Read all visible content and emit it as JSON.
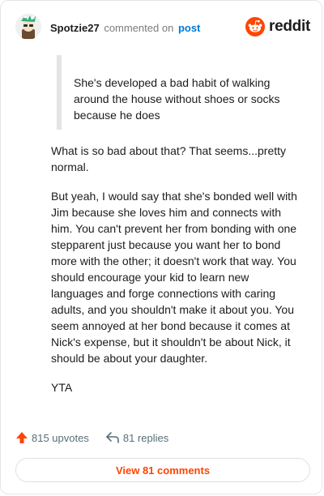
{
  "header": {
    "username": "Spotzie27",
    "action_text": "commented on",
    "post_link": "post",
    "logo_text": "reddit",
    "brand_color": "#ff4500",
    "avatar_icon": "user-avatar-icon"
  },
  "quote": {
    "text": "She's developed a bad habit of walking around the house without shoes or socks because he does"
  },
  "body": {
    "paragraphs": [
      "What is so bad about that? That seems...pretty normal.",
      "But yeah, I would say that she's bonded well with Jim because she loves him and connects with him. You can't prevent her from bonding with one stepparent just because you want her to bond more with the other; it doesn't work that way. You should encourage your kid to learn new languages and forge connections with caring adults, and you shouldn't make it about you. You seem annoyed at her bond because it comes at Nick's expense, but it shouldn't be about Nick, it should be about your daughter.",
      "YTA"
    ]
  },
  "footer": {
    "upvotes_label": "815 upvotes",
    "replies_label": "81 replies",
    "view_comments_label": "View 81 comments",
    "upvote_icon": "upvote-arrow-icon",
    "reply_icon": "reply-arrow-icon",
    "accent_color": "#ff4500"
  }
}
